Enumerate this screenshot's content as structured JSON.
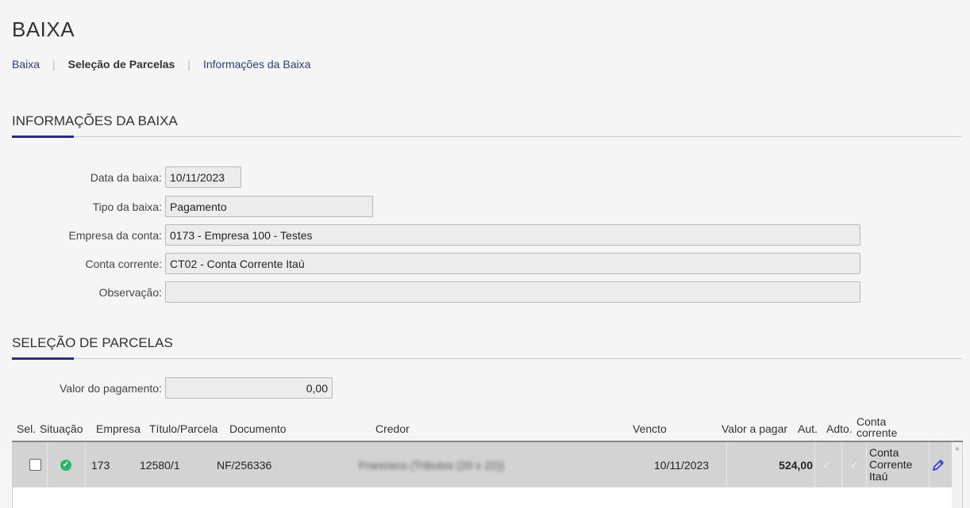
{
  "page": {
    "title": "BAIXA"
  },
  "breadcrumb": {
    "items": [
      "Baixa",
      "Seleção de Parcelas",
      "Informações da Baixa"
    ]
  },
  "info_section": {
    "title": "INFORMAÇÕES DA BAIXA",
    "fields": {
      "data_baixa": {
        "label": "Data da baixa:",
        "value": "10/11/2023"
      },
      "tipo_baixa": {
        "label": "Tipo da baixa:",
        "value": "Pagamento"
      },
      "empresa_conta": {
        "label": "Empresa da conta:",
        "value": "0173 - Empresa 100 - Testes"
      },
      "conta_corrente": {
        "label": "Conta corrente:",
        "value": "CT02 - Conta Corrente Itaú"
      },
      "observacao": {
        "label": "Observação:",
        "value": ""
      }
    }
  },
  "selection_section": {
    "title": "SELEÇÃO DE PARCELAS",
    "valor_pagamento": {
      "label": "Valor do pagamento:",
      "value": "0,00"
    }
  },
  "table": {
    "columns": {
      "sel": "Sel.",
      "situacao": "Situação",
      "empresa": "Empresa",
      "titulo": "Título/Parcela",
      "documento": "Documento",
      "credor": "Credor",
      "vencto": "Vencto",
      "valor": "Valor a pagar",
      "aut": "Aut.",
      "adto": "Adto.",
      "conta": "Conta corrente"
    },
    "rows": [
      {
        "empresa": "173",
        "titulo": "12580/1",
        "documento": "NF/256336",
        "credor": "Francisco (Tributos (20 x 22))",
        "vencto": "10/11/2023",
        "valor": "524,00",
        "aut_icon": "check-icon",
        "adto_icon": "check-icon",
        "conta": "Conta Corrente Itaú",
        "situacao_icon": "check-circle-icon",
        "situacao_color": "#2fb36a"
      }
    ]
  },
  "colors": {
    "accent": "#2a2f7a",
    "link": "#2c3e7a",
    "edit_icon": "#3a3fd0"
  }
}
